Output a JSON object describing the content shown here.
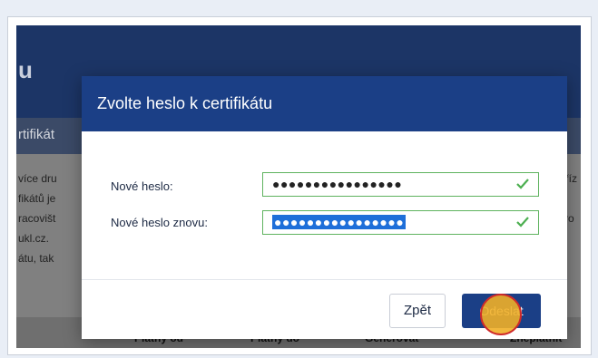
{
  "background": {
    "logo_fragment": "u",
    "section_title": "rtifikát",
    "body_lines": [
      "více dru",
      "fikátů je",
      "racovišt",
      "ukl.cz.",
      "átu, tak"
    ],
    "right_fragments": [
      "ké zaříz",
      "KL, pro"
    ],
    "table_headers": [
      "Platný od",
      "Platný do",
      "Generovat",
      "Zneplatnit"
    ]
  },
  "modal": {
    "title": "Zvolte heslo k certifikátu",
    "fields": [
      {
        "label": "Nové heslo:",
        "value": "●●●●●●●●●●●●●●●●",
        "valid": true
      },
      {
        "label": "Nové heslo znovu:",
        "value": "●●●●●●●●●●●●●●●●",
        "valid": true
      }
    ],
    "back_label": "Zpět",
    "submit_label": "Odeslat"
  },
  "colors": {
    "header": "#1b3f86",
    "valid": "#5fb35f",
    "selection": "#1e6fd9"
  }
}
